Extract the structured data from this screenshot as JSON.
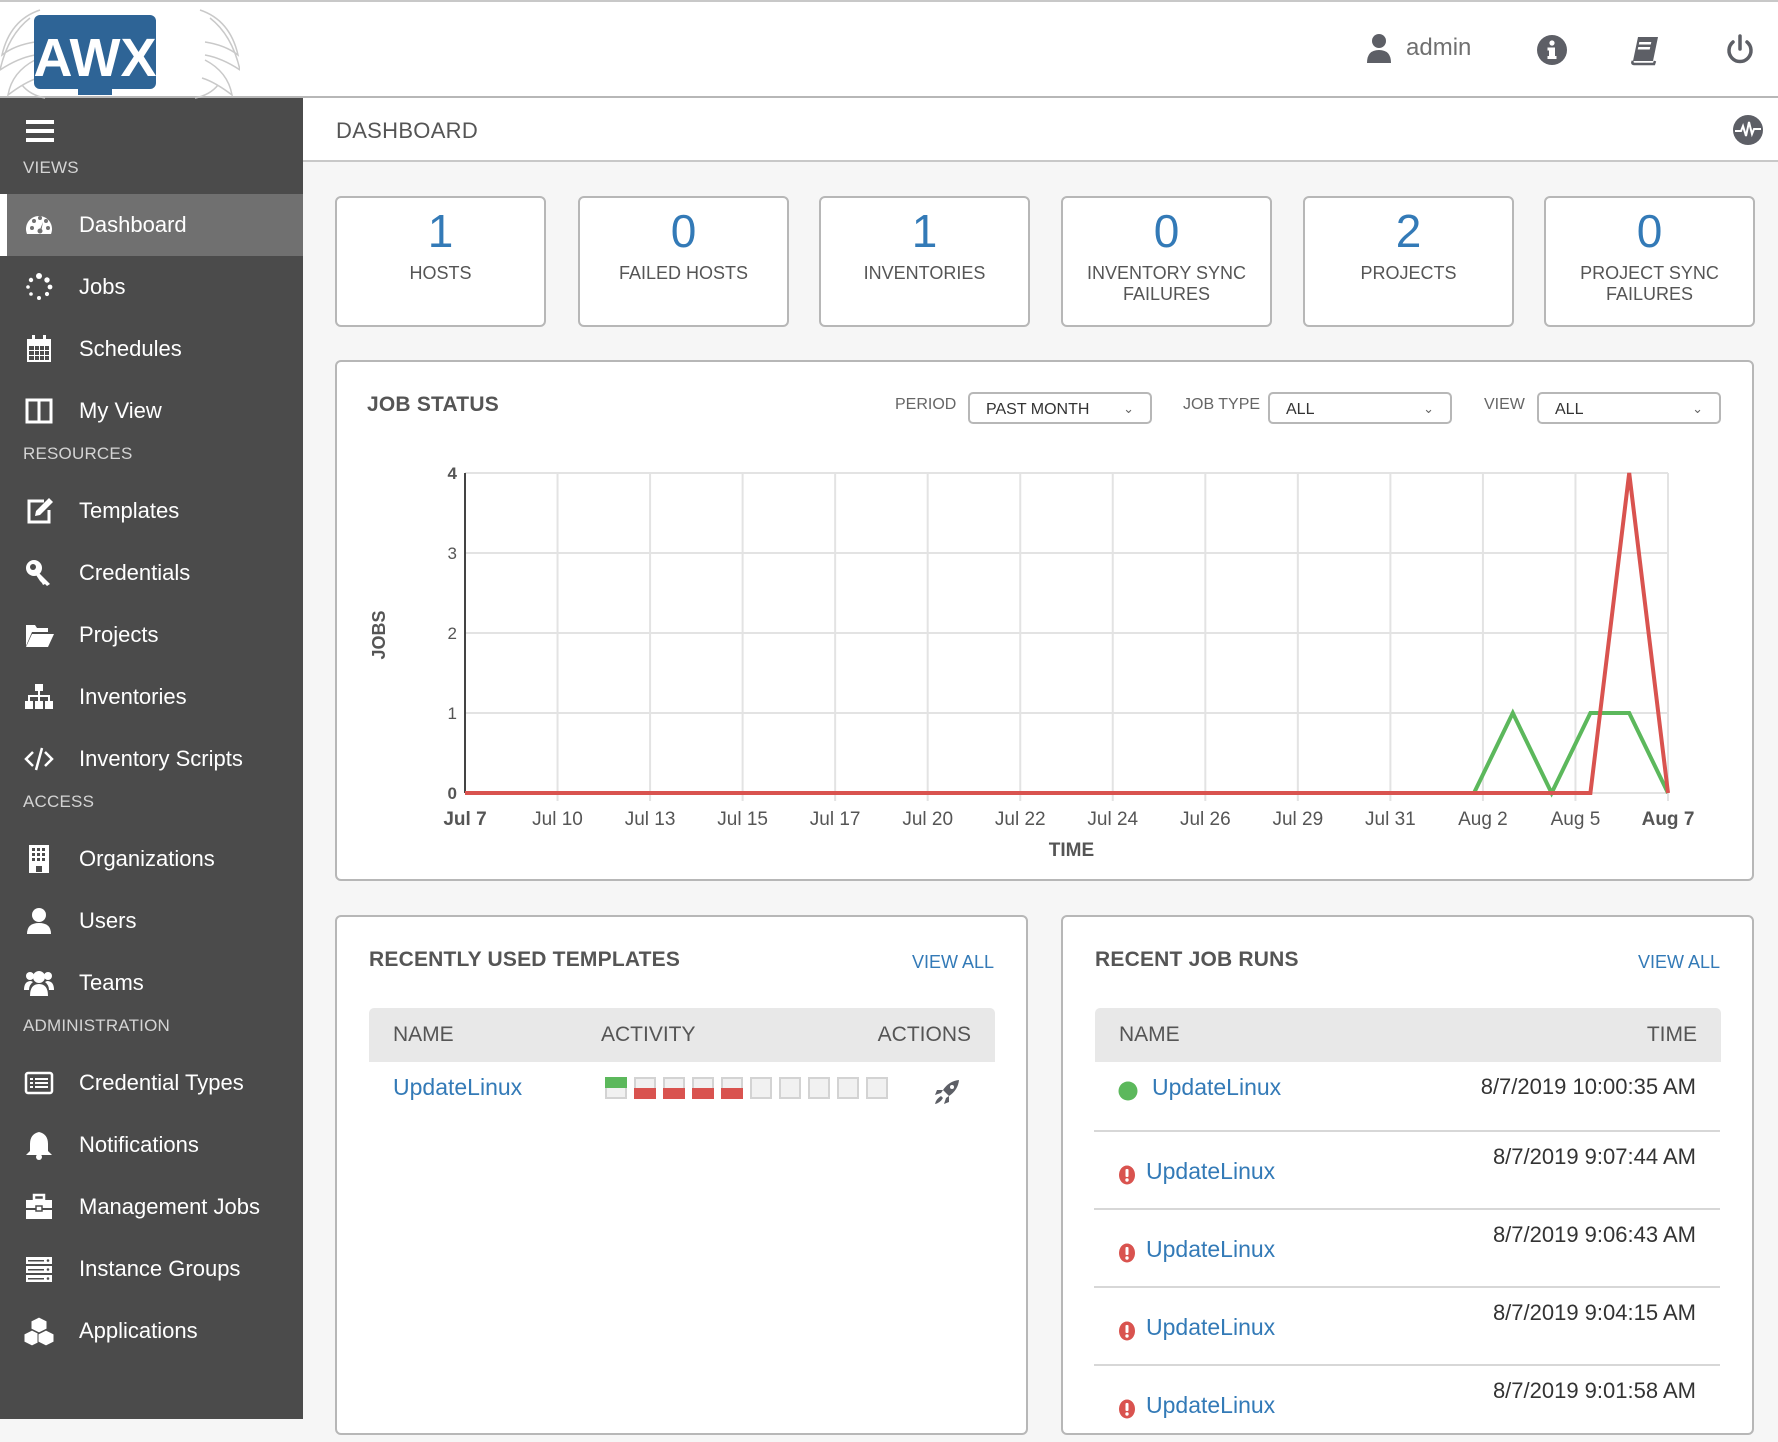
{
  "header": {
    "logo_text": "AWX",
    "username": "admin",
    "icons": [
      "user-icon",
      "info-icon",
      "docs-book-icon",
      "logout-power-icon"
    ]
  },
  "subheader": {
    "title": "DASHBOARD",
    "activity_icon": "activity-stream-icon"
  },
  "sidebar": {
    "groups": [
      {
        "label": "VIEWS",
        "items": [
          {
            "label": "Dashboard",
            "icon": "dashboard-icon",
            "active": true
          },
          {
            "label": "Jobs",
            "icon": "jobs-spinner-icon"
          },
          {
            "label": "Schedules",
            "icon": "calendar-icon"
          },
          {
            "label": "My View",
            "icon": "columns-icon"
          }
        ]
      },
      {
        "label": "RESOURCES",
        "items": [
          {
            "label": "Templates",
            "icon": "edit-icon"
          },
          {
            "label": "Credentials",
            "icon": "key-icon"
          },
          {
            "label": "Projects",
            "icon": "folder-open-icon"
          },
          {
            "label": "Inventories",
            "icon": "sitemap-icon"
          },
          {
            "label": "Inventory Scripts",
            "icon": "code-icon"
          }
        ]
      },
      {
        "label": "ACCESS",
        "items": [
          {
            "label": "Organizations",
            "icon": "building-icon"
          },
          {
            "label": "Users",
            "icon": "user-icon"
          },
          {
            "label": "Teams",
            "icon": "users-icon"
          }
        ]
      },
      {
        "label": "ADMINISTRATION",
        "items": [
          {
            "label": "Credential Types",
            "icon": "list-alt-icon"
          },
          {
            "label": "Notifications",
            "icon": "bell-icon"
          },
          {
            "label": "Management Jobs",
            "icon": "briefcase-icon"
          },
          {
            "label": "Instance Groups",
            "icon": "server-icon"
          },
          {
            "label": "Applications",
            "icon": "cubes-icon"
          }
        ]
      }
    ]
  },
  "counts": [
    {
      "value": "1",
      "label": "HOSTS"
    },
    {
      "value": "0",
      "label": "FAILED HOSTS"
    },
    {
      "value": "1",
      "label": "INVENTORIES"
    },
    {
      "value": "0",
      "label": "INVENTORY SYNC FAILURES"
    },
    {
      "value": "2",
      "label": "PROJECTS"
    },
    {
      "value": "0",
      "label": "PROJECT SYNC FAILURES"
    }
  ],
  "job_status": {
    "title": "JOB STATUS",
    "filters": [
      {
        "label": "PERIOD",
        "value": "PAST MONTH"
      },
      {
        "label": "JOB TYPE",
        "value": "ALL"
      },
      {
        "label": "VIEW",
        "value": "ALL"
      }
    ]
  },
  "chart_data": {
    "type": "line",
    "title": "JOB STATUS",
    "xlabel": "TIME",
    "ylabel": "JOBS",
    "ylim": [
      0,
      4
    ],
    "yticks": [
      "0",
      "1",
      "2",
      "3",
      "4"
    ],
    "xtick_labels": [
      "Jul 7",
      "Jul 10",
      "Jul 13",
      "Jul 15",
      "Jul 17",
      "Jul 20",
      "Jul 22",
      "Jul 24",
      "Jul 26",
      "Jul 29",
      "Jul 31",
      "Aug 2",
      "Aug 5",
      "Aug 7"
    ],
    "bold_ticks": [
      "Jul 7",
      "Aug 7"
    ],
    "x": [
      "Jul 7",
      "Jul 8",
      "Jul 9",
      "Jul 10",
      "Jul 11",
      "Jul 12",
      "Jul 13",
      "Jul 14",
      "Jul 15",
      "Jul 16",
      "Jul 17",
      "Jul 18",
      "Jul 19",
      "Jul 20",
      "Jul 21",
      "Jul 22",
      "Jul 23",
      "Jul 24",
      "Jul 25",
      "Jul 26",
      "Jul 27",
      "Jul 28",
      "Jul 29",
      "Jul 30",
      "Jul 31",
      "Aug 1",
      "Aug 2",
      "Aug 3",
      "Aug 4",
      "Aug 5",
      "Aug 6",
      "Aug 7"
    ],
    "grid": true,
    "series": [
      {
        "name": "Successful",
        "color": "#5cb85c",
        "values": [
          0,
          0,
          0,
          0,
          0,
          0,
          0,
          0,
          0,
          0,
          0,
          0,
          0,
          0,
          0,
          0,
          0,
          0,
          0,
          0,
          0,
          0,
          0,
          0,
          0,
          0,
          0,
          1,
          0,
          1,
          1,
          0
        ]
      },
      {
        "name": "Failed",
        "color": "#d9534f",
        "values": [
          0,
          0,
          0,
          0,
          0,
          0,
          0,
          0,
          0,
          0,
          0,
          0,
          0,
          0,
          0,
          0,
          0,
          0,
          0,
          0,
          0,
          0,
          0,
          0,
          0,
          0,
          0,
          0,
          0,
          0,
          4,
          0
        ]
      }
    ]
  },
  "templates_panel": {
    "title": "RECENTLY USED TEMPLATES",
    "view_all": "VIEW ALL",
    "columns": [
      "NAME",
      "ACTIVITY",
      "ACTIONS"
    ],
    "rows": [
      {
        "name": "UpdateLinux",
        "activity": [
          "success",
          "failed",
          "failed",
          "failed",
          "failed",
          "none",
          "none",
          "none",
          "none",
          "none"
        ],
        "action_icon": "rocket-launch-icon"
      }
    ]
  },
  "jobs_panel": {
    "title": "RECENT JOB RUNS",
    "view_all": "VIEW ALL",
    "columns": [
      "NAME",
      "TIME"
    ],
    "rows": [
      {
        "status": "success",
        "name": "UpdateLinux",
        "time": "8/7/2019 10:00:35 AM"
      },
      {
        "status": "failed",
        "name": "UpdateLinux",
        "time": "8/7/2019 9:07:44 AM"
      },
      {
        "status": "failed",
        "name": "UpdateLinux",
        "time": "8/7/2019 9:06:43 AM"
      },
      {
        "status": "failed",
        "name": "UpdateLinux",
        "time": "8/7/2019 9:04:15 AM"
      },
      {
        "status": "failed",
        "name": "UpdateLinux",
        "time": "8/7/2019 9:01:58 AM"
      }
    ]
  },
  "colors": {
    "accent": "#337ab7",
    "success": "#5cb85c",
    "failed": "#d9534f",
    "sidebar_bg": "#4b4b4b",
    "sidebar_active": "#707070",
    "logo_blue": "#2e6496"
  }
}
